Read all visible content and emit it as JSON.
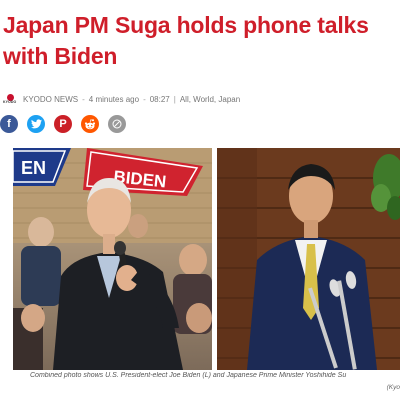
{
  "article": {
    "headline": "Japan PM Suga holds phone talks with Biden",
    "source_logo": "KYODO",
    "source": "KYODO NEWS",
    "time_ago": "4 minutes ago",
    "time": "08:27",
    "categories": "All, World, Japan",
    "byline_sep": "-",
    "byline_bar": "|"
  },
  "share": {
    "facebook_glyph": "f",
    "twitter_glyph": "t",
    "pinterest_glyph": "P",
    "reddit_glyph": "r",
    "colors": {
      "facebook": "#3b5998",
      "twitter": "#1da1f2",
      "pinterest": "#cb2027",
      "reddit": "#ff5700",
      "email": "#999999"
    }
  },
  "photo": {
    "sign_left_text": "EN",
    "sign_right_text": "BIDEN",
    "caption": "Combined photo shows U.S. President-elect Joe Biden (L) and Japanese Prime Minister Yoshihide Su",
    "credit": "(Kyo"
  },
  "colors": {
    "headline": "#cf1e2a",
    "sign_blue": "#1e3a8a",
    "sign_red": "#d0232f"
  },
  "icons": {
    "facebook": "facebook-icon",
    "twitter": "twitter-icon",
    "pinterest": "pinterest-icon",
    "reddit": "reddit-icon",
    "email": "email-icon"
  }
}
